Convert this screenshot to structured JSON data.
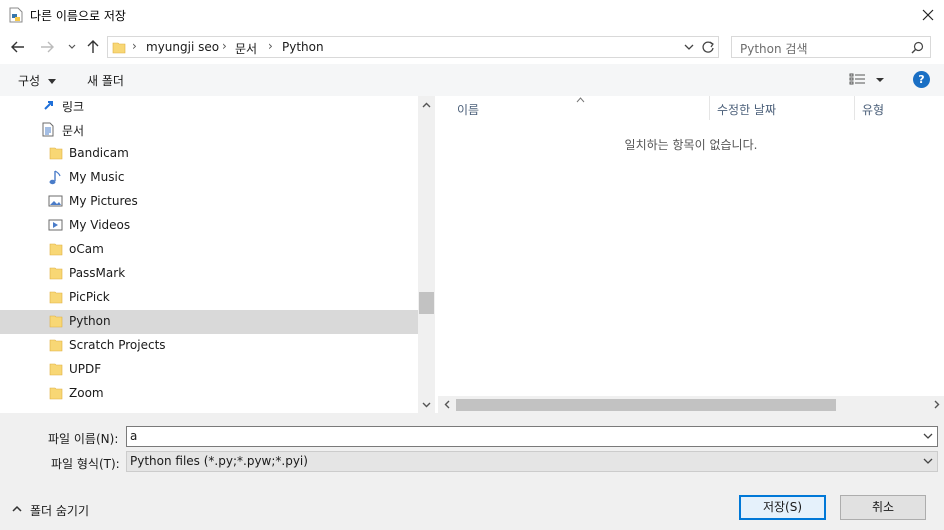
{
  "window": {
    "title": "다른 이름으로 저장"
  },
  "address": {
    "crumbs": [
      "myungji seo",
      "문서",
      "Python"
    ],
    "separator": "›"
  },
  "search": {
    "placeholder": "Python 검색"
  },
  "toolbar": {
    "organize_label": "구성",
    "new_folder_label": "새 폴더"
  },
  "nav": {
    "items": [
      {
        "label": "링크",
        "icon": "link-icon"
      },
      {
        "label": "문서",
        "icon": "document-icon"
      },
      {
        "label": "Bandicam",
        "icon": "folder-icon"
      },
      {
        "label": "My Music",
        "icon": "music-folder-icon"
      },
      {
        "label": "My Pictures",
        "icon": "pictures-folder-icon"
      },
      {
        "label": "My Videos",
        "icon": "videos-folder-icon"
      },
      {
        "label": "oCam",
        "icon": "folder-icon"
      },
      {
        "label": "PassMark",
        "icon": "folder-icon"
      },
      {
        "label": "PicPick",
        "icon": "folder-icon"
      },
      {
        "label": "Python",
        "icon": "folder-icon",
        "selected": true
      },
      {
        "label": "Scratch Projects",
        "icon": "folder-icon"
      },
      {
        "label": "UPDF",
        "icon": "folder-icon"
      },
      {
        "label": "Zoom",
        "icon": "folder-icon"
      }
    ]
  },
  "list": {
    "columns": [
      "이름",
      "수정한 날짜",
      "유형"
    ],
    "empty_message": "일치하는 항목이 없습니다."
  },
  "form": {
    "filename_label": "파일 이름(N):",
    "filename_value": "a",
    "filetype_label": "파일 형식(T):",
    "filetype_value": "Python files (*.py;*.pyw;*.pyi)"
  },
  "footer": {
    "hide_folders_label": "폴더 숨기기",
    "save_label": "저장(S)",
    "cancel_label": "취소"
  },
  "colors": {
    "accent": "#0078d7",
    "selected_row": "#d9d9d9",
    "help": "#1a6fc4"
  }
}
